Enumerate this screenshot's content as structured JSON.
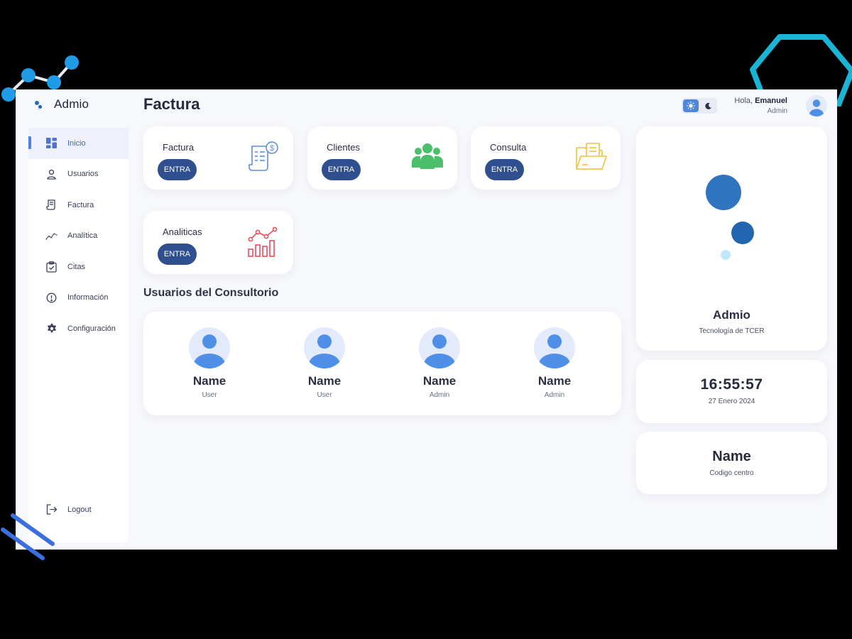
{
  "app": {
    "brand": "Admio",
    "page_title": "Factura"
  },
  "topbar": {
    "greeting_prefix": "Hola,",
    "user_name": "Emanuel",
    "user_role": "Admin"
  },
  "sidebar": {
    "items": [
      {
        "label": "Inicio",
        "icon": "dashboard-icon",
        "active": true
      },
      {
        "label": "Usuarios",
        "icon": "user-icon"
      },
      {
        "label": "Factura",
        "icon": "receipt-icon"
      },
      {
        "label": "Analítica",
        "icon": "trend-icon"
      },
      {
        "label": "Citas",
        "icon": "clipboard-check-icon"
      },
      {
        "label": "Información",
        "icon": "info-icon"
      },
      {
        "label": "Configuración",
        "icon": "gear-icon"
      }
    ],
    "logout": {
      "label": "Logout",
      "icon": "logout-icon"
    }
  },
  "quick_cards": [
    {
      "title": "Factura",
      "button": "ENTRA",
      "icon": "invoice-icon",
      "color": "#5b8fe0"
    },
    {
      "title": "Clientes",
      "button": "ENTRA",
      "icon": "group-icon",
      "color": "#4cbf6a"
    },
    {
      "title": "Consulta",
      "button": "ENTRA",
      "icon": "folder-icon",
      "color": "#f0c23c"
    },
    {
      "title": "Analiticas",
      "button": "ENTRA",
      "icon": "chart-icon",
      "color": "#e5505a"
    }
  ],
  "users_section": {
    "title": "Usuarios del Consultorio",
    "users": [
      {
        "name": "Name",
        "role": "User"
      },
      {
        "name": "Name",
        "role": "User"
      },
      {
        "name": "Name",
        "role": "Admin"
      },
      {
        "name": "Name",
        "role": "Admin"
      }
    ]
  },
  "brand_card": {
    "title": "Admio",
    "subtitle": "Tecnología de TCER"
  },
  "clock": {
    "time": "16:55:57",
    "date": "27 Enero 2024"
  },
  "center": {
    "name": "Name",
    "label": "Codigo centro"
  },
  "colors": {
    "accent": "#2f4f8f",
    "brand_blue": "#2a6bb8",
    "avatar_blue": "#4f8fe8",
    "background": "#f7f8fc"
  }
}
